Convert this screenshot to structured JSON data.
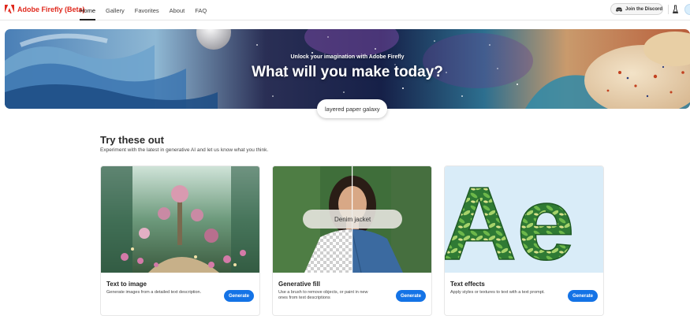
{
  "app": {
    "brand": "Adobe Firefly (Beta)",
    "brand_color": "#e0291d",
    "logo_icon": "adobe-logo-icon"
  },
  "nav": {
    "items": [
      {
        "label": "Home",
        "active": true
      },
      {
        "label": "Gallery",
        "active": false
      },
      {
        "label": "Favorites",
        "active": false
      },
      {
        "label": "About",
        "active": false
      },
      {
        "label": "FAQ",
        "active": false
      }
    ]
  },
  "header_actions": {
    "discord_label": "Join the Discord",
    "discord_icon": "discord-icon",
    "lab_icon": "beaker-icon",
    "avatar_icon": "user-avatar"
  },
  "hero": {
    "eyebrow": "Unlock your imagination with Adobe Firefly",
    "title": "What will you make today?",
    "prompt_value": "layered paper galaxy"
  },
  "section": {
    "title": "Try these out",
    "subtitle": "Experiment with the latest in generative AI and let us know what you think."
  },
  "cards": [
    {
      "title": "Text to image",
      "description": "Generate images from a detailed text description.",
      "button": "Generate"
    },
    {
      "title": "Generative fill",
      "description": "Use a brush to remove objects, or paint in new ones from text descriptions",
      "button": "Generate",
      "overlay_prompt": "Denim jacket"
    },
    {
      "title": "Text effects",
      "description": "Apply styles or textures to text with a text prompt.",
      "button": "Generate",
      "overlay_letters": "Ae"
    }
  ],
  "colors": {
    "accent": "#1473e6",
    "text": "#2c2c2c"
  }
}
